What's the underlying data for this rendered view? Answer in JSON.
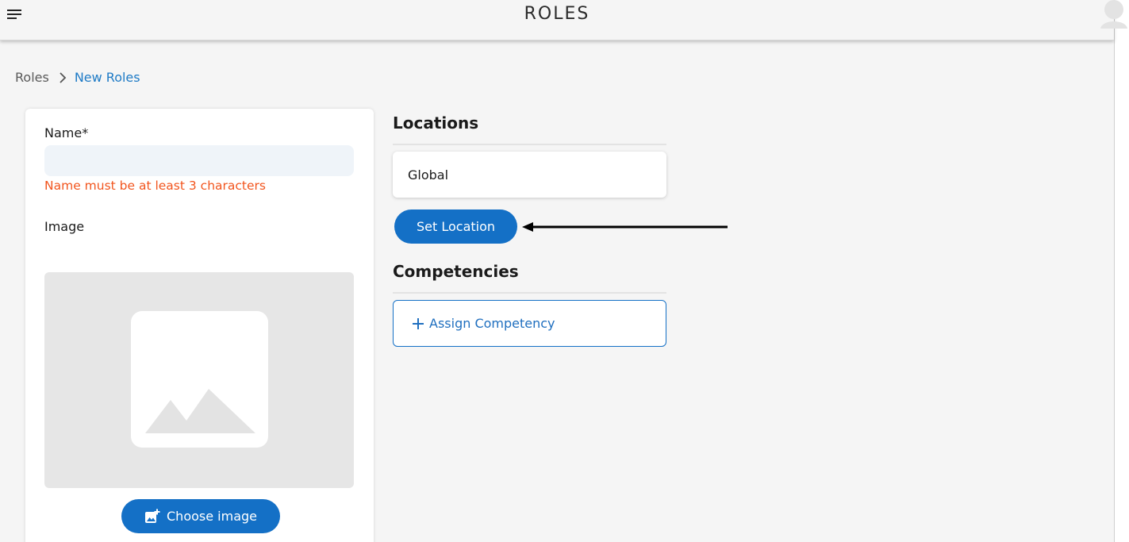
{
  "header": {
    "title": "ROLES",
    "menu_icon": "hamburger-menu-icon",
    "avatar_icon": "user-avatar-icon"
  },
  "breadcrumb": {
    "root": "Roles",
    "separator_icon": "chevron-right-icon",
    "current": "New Roles"
  },
  "form": {
    "name_label": "Name*",
    "name_value": "",
    "name_placeholder": "",
    "name_error": "Name must be at least 3 characters",
    "image_label": "Image",
    "image_placeholder_icon": "image-placeholder-icon",
    "choose_image_label": "Choose image",
    "choose_image_icon": "add-photo-icon"
  },
  "locations": {
    "title": "Locations",
    "selected": "Global",
    "set_location_label": "Set Location"
  },
  "competencies": {
    "title": "Competencies",
    "assign_label": "Assign Competency",
    "assign_icon": "plus-icon"
  },
  "annotation": {
    "arrow_icon": "arrow-left-icon"
  },
  "colors": {
    "primary": "#1470c6",
    "link": "#1f7bc6",
    "error": "#f2551e",
    "input_bg": "#eff4f9",
    "placeholder_bg": "#e6e6e6"
  }
}
